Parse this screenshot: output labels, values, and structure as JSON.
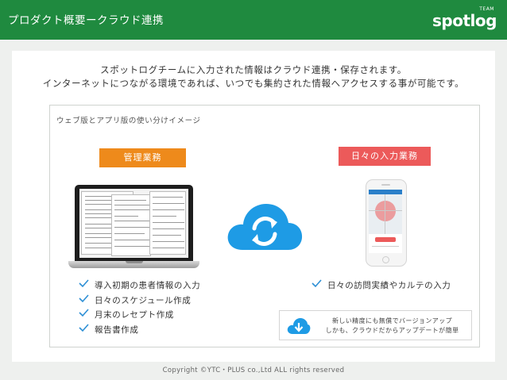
{
  "header": {
    "title": "プロダクト概要ークラウド連携",
    "logo_text": "spotlog",
    "logo_tag": "TEAM"
  },
  "intro": {
    "line1": "スポットログチームに入力された情報はクラウド連携・保存されます。",
    "line2": "インターネットにつながる環境であれば、いつでも集約された情報へアクセスする事が可能です。"
  },
  "section": {
    "caption": "ウェブ版とアプリ版の使い分けイメージ",
    "admin_label": "管理業務",
    "daily_label": "日々の入力業務"
  },
  "admin_tasks": [
    "導入初期の患者情報の入力",
    "日々のスケジュール作成",
    "月末のレセプト作成",
    "報告書作成"
  ],
  "daily_tasks": [
    "日々の訪問実績やカルテの入力"
  ],
  "update_note": {
    "line1": "新しい精度にも無償でバージョンアップ",
    "line2": "しかも、クラウドだからアップデートが簡単"
  },
  "footer": "Copyright ©YTC・PLUS co.,Ltd ALL rights reserved",
  "colors": {
    "header_green": "#1f8a3f",
    "admin_orange": "#ee8a1b",
    "daily_red": "#ec5a5a",
    "cloud_blue": "#1e9be5",
    "check_blue": "#2d8fd5"
  },
  "icons": {
    "cloud": "cloud-sync-icon",
    "check": "check-icon",
    "download": "cloud-download-icon"
  }
}
